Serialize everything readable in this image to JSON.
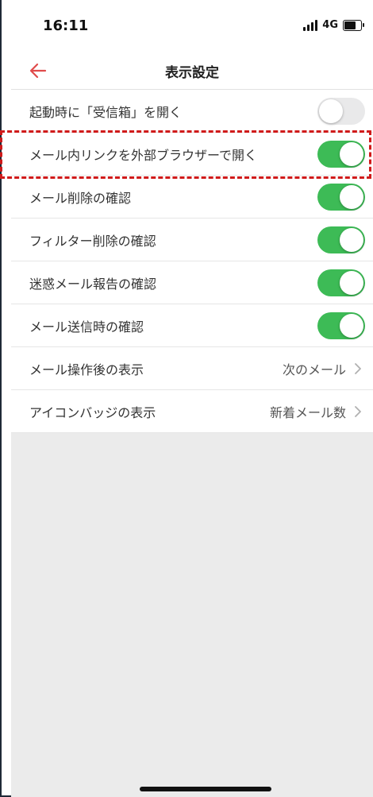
{
  "status_bar": {
    "time": "16:11",
    "network": "4G",
    "icons": [
      "signal-icon",
      "battery-icon"
    ]
  },
  "header": {
    "title": "表示設定",
    "back_icon": "arrow-left-icon",
    "accent_color": "#e04b4b"
  },
  "settings": [
    {
      "label": "起動時に「受信箱」を開く",
      "type": "toggle",
      "on": false
    },
    {
      "label": "メール内リンクを外部ブラウザーで開く",
      "type": "toggle",
      "on": true,
      "highlighted": true
    },
    {
      "label": "メール削除の確認",
      "type": "toggle",
      "on": true
    },
    {
      "label": "フィルター削除の確認",
      "type": "toggle",
      "on": true
    },
    {
      "label": "迷惑メール報告の確認",
      "type": "toggle",
      "on": true
    },
    {
      "label": "メール送信時の確認",
      "type": "toggle",
      "on": true
    },
    {
      "label": "メール操作後の表示",
      "type": "select",
      "value": "次のメール"
    },
    {
      "label": "アイコンバッジの表示",
      "type": "select",
      "value": "新着メール数"
    }
  ],
  "colors": {
    "toggle_on": "#3dbb56",
    "toggle_off": "#e9e9ea",
    "highlight_border": "#d01a1a",
    "background": "#ebebeb"
  }
}
